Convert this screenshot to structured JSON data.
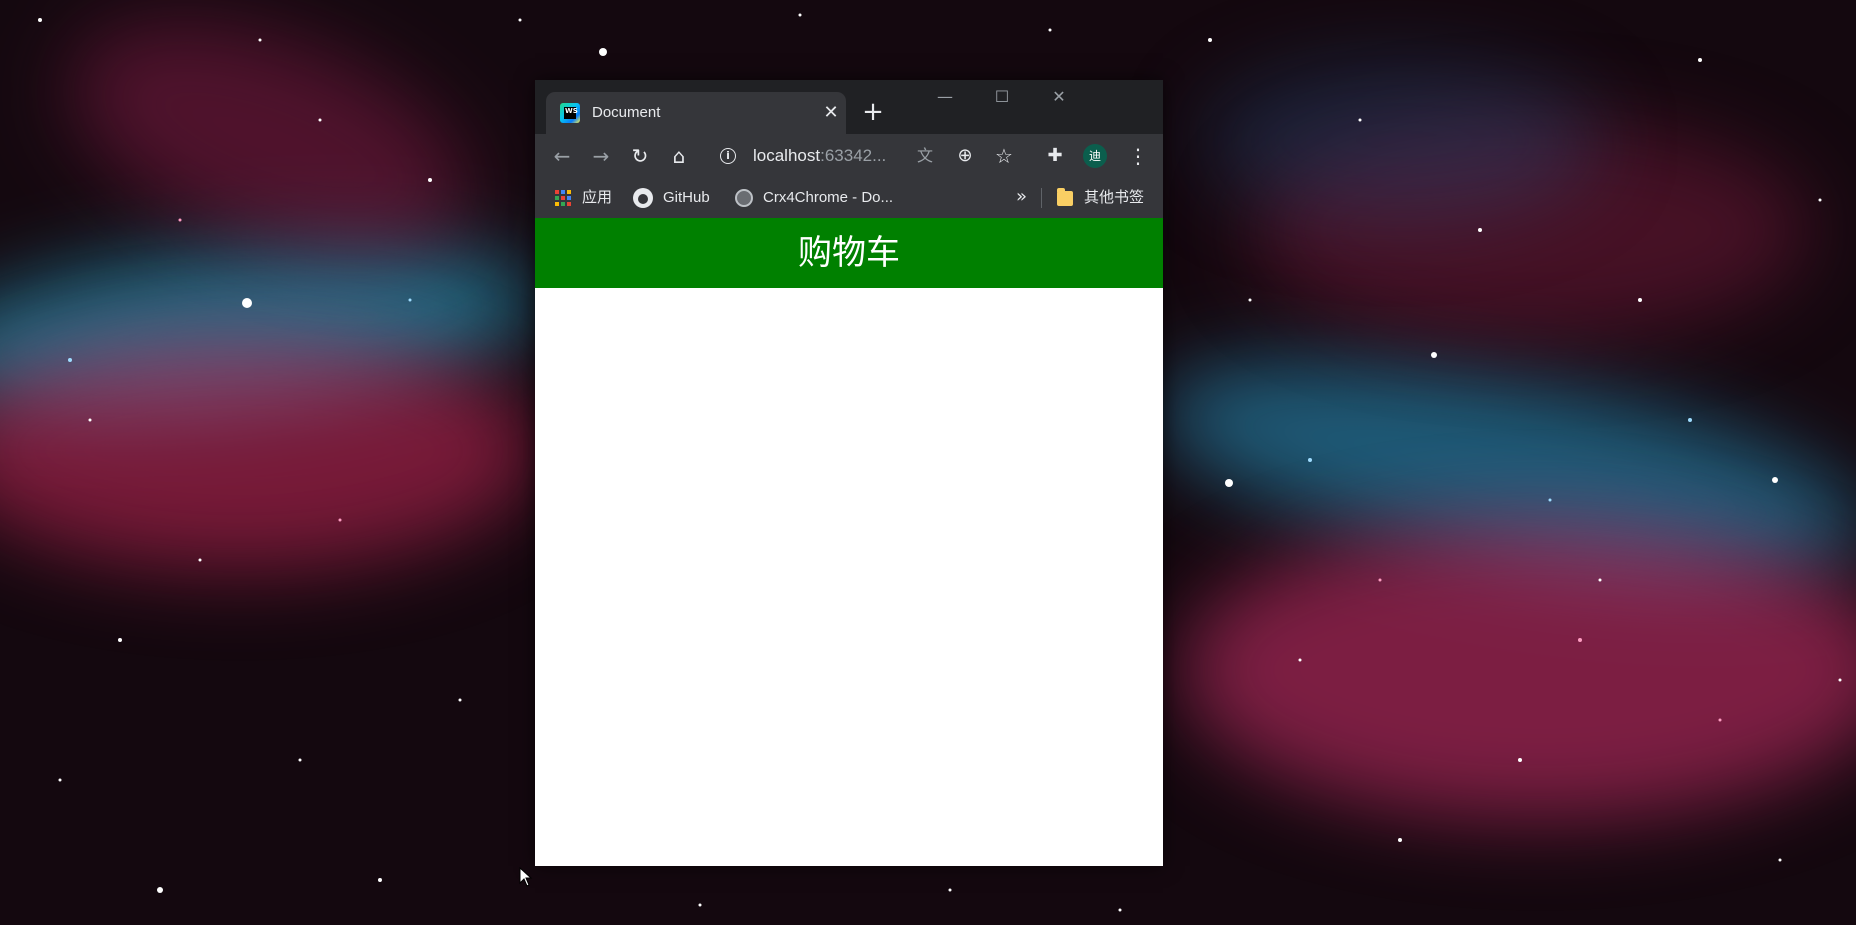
{
  "browser": {
    "tab": {
      "title": "Document",
      "close_glyph": "✕",
      "favicon": "webstorm-icon"
    },
    "new_tab_glyph": "+",
    "window_controls": {
      "minimize": "—",
      "maximize": "☐",
      "close": "✕"
    },
    "toolbar": {
      "back_glyph": "←",
      "forward_glyph": "→",
      "reload_glyph": "↻",
      "home_glyph": "⌂",
      "info_glyph": "i",
      "url_host": "localhost",
      "url_port": ":63342...",
      "translate_glyph": "文",
      "zoom_glyph": "⊕",
      "star_glyph": "☆",
      "extensions_glyph": "✚",
      "avatar_text": "迪",
      "menu_glyph": "⋮"
    },
    "bookmarks": {
      "items": [
        {
          "label": "应用",
          "icon": "apps-grid-icon"
        },
        {
          "label": "GitHub",
          "icon": "github-icon"
        },
        {
          "label": "Crx4Chrome - Do...",
          "icon": "globe-icon"
        }
      ],
      "more_glyph": "»",
      "other_bookmarks": "其他书签"
    }
  },
  "page": {
    "header_title": "购物车",
    "header_color": "#008000"
  }
}
